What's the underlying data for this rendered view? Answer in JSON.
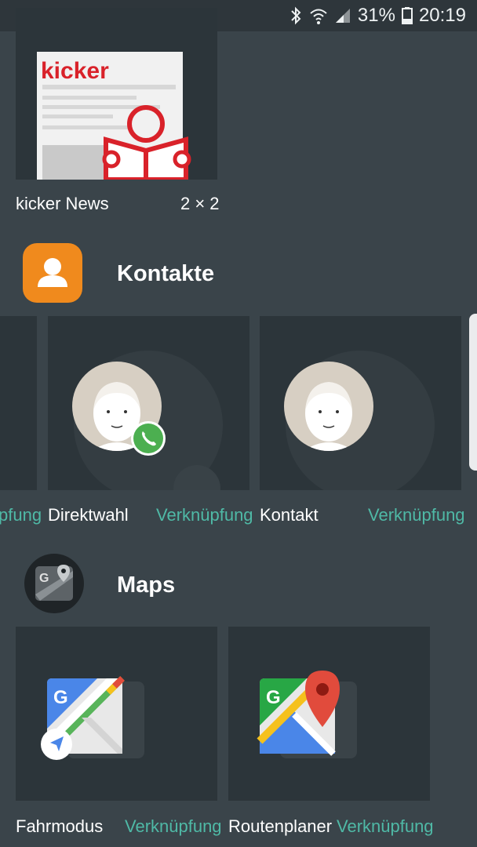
{
  "status_bar": {
    "battery_percent": "31%",
    "time": "20:19",
    "icons": [
      "bluetooth-icon",
      "wifi-icon",
      "signal-icon",
      "battery-icon"
    ]
  },
  "widget_kicker": {
    "name": "kicker News",
    "size": "2 × 2",
    "logo_text": "kicker"
  },
  "section_kontakte": {
    "title": "Kontakte",
    "items": [
      {
        "name": "",
        "type": "pfung"
      },
      {
        "name": "Direktwahl",
        "type": "Verknüpfung"
      },
      {
        "name": "Kontakt",
        "type": "Verknüpfung"
      }
    ]
  },
  "section_maps": {
    "title": "Maps",
    "items": [
      {
        "name": "Fahrmodus",
        "type": "Verknüpfung"
      },
      {
        "name": "Routenplaner",
        "type": "Verknüpfung"
      }
    ]
  },
  "colors": {
    "background": "#3a444a",
    "tile": "#2c353a",
    "accent": "#4fb9a6",
    "kicker_red": "#d9222a",
    "kontakte_orange": "#f08a1d"
  }
}
